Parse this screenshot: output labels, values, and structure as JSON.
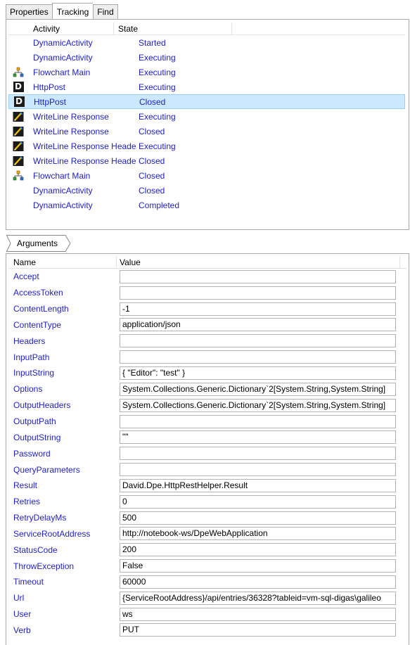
{
  "tabs": [
    {
      "label": "Properties",
      "active": false
    },
    {
      "label": "Tracking",
      "active": true
    },
    {
      "label": "Find",
      "active": false
    }
  ],
  "tracking": {
    "columns": {
      "activity": "Activity",
      "state": "State"
    },
    "rows": [
      {
        "icon": "none",
        "activity": "DynamicActivity",
        "state": "Started"
      },
      {
        "icon": "none",
        "activity": "DynamicActivity",
        "state": "Executing"
      },
      {
        "icon": "flowchart-icon",
        "activity": "Flowchart Main",
        "state": "Executing"
      },
      {
        "icon": "dynamic-d-icon",
        "activity": "HttpPost",
        "state": "Executing"
      },
      {
        "icon": "dynamic-d-icon",
        "activity": "HttpPost",
        "state": "Closed",
        "selected": true
      },
      {
        "icon": "writeline-icon",
        "activity": "WriteLine Response",
        "state": "Executing"
      },
      {
        "icon": "writeline-icon",
        "activity": "WriteLine Response",
        "state": "Closed"
      },
      {
        "icon": "writeline-icon",
        "activity": "WriteLine Response Heade",
        "state": "Executing"
      },
      {
        "icon": "writeline-icon",
        "activity": "WriteLine Response Heade",
        "state": "Closed"
      },
      {
        "icon": "flowchart-icon",
        "activity": "Flowchart Main",
        "state": "Closed"
      },
      {
        "icon": "none",
        "activity": "DynamicActivity",
        "state": "Closed"
      },
      {
        "icon": "none",
        "activity": "DynamicActivity",
        "state": "Completed"
      }
    ]
  },
  "breadcrumb": {
    "label": "Arguments"
  },
  "arguments": {
    "columns": {
      "name": "Name",
      "value": "Value"
    },
    "rows": [
      {
        "name": "Accept",
        "value": ""
      },
      {
        "name": "AccessToken",
        "value": ""
      },
      {
        "name": "ContentLength",
        "value": "-1"
      },
      {
        "name": "ContentType",
        "value": "application/json"
      },
      {
        "name": "Headers",
        "value": ""
      },
      {
        "name": "InputPath",
        "value": ""
      },
      {
        "name": "InputString",
        "value": "{ \"Editor\": \"test\" }"
      },
      {
        "name": "Options",
        "value": "System.Collections.Generic.Dictionary`2[System.String,System.String]"
      },
      {
        "name": "OutputHeaders",
        "value": "System.Collections.Generic.Dictionary`2[System.String,System.String]"
      },
      {
        "name": "OutputPath",
        "value": ""
      },
      {
        "name": "OutputString",
        "value": "\"\""
      },
      {
        "name": "Password",
        "value": ""
      },
      {
        "name": "QueryParameters",
        "value": ""
      },
      {
        "name": "Result",
        "value": "David.Dpe.HttpRestHelper.Result"
      },
      {
        "name": "Retries",
        "value": "0"
      },
      {
        "name": "RetryDelayMs",
        "value": "500"
      },
      {
        "name": "ServiceRootAddress",
        "value": "http://notebook-ws/DpeWebApplication"
      },
      {
        "name": "StatusCode",
        "value": "200"
      },
      {
        "name": "ThrowException",
        "value": "False"
      },
      {
        "name": "Timeout",
        "value": "60000"
      },
      {
        "name": "Url",
        "value": "{ServiceRootAddress}/api/entries/36328?tableid=vm-sql-digas\\galileo"
      },
      {
        "name": "User",
        "value": "ws"
      },
      {
        "name": "Verb",
        "value": "PUT"
      }
    ]
  },
  "colors": {
    "link_text": "#1e1ec8",
    "selection": "#cce8ff",
    "selection_border": "#99d1ff",
    "border": "#a9a9a9"
  }
}
